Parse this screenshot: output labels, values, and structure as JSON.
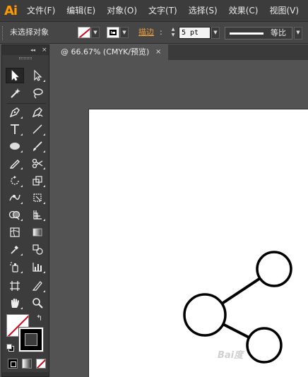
{
  "app": {
    "logo": "Ai"
  },
  "menu": [
    "文件(F)",
    "编辑(E)",
    "对象(O)",
    "文字(T)",
    "选择(S)",
    "效果(C)",
    "视图(V)"
  ],
  "control_bar": {
    "selection_status": "未选择对象",
    "stroke_label": "描边",
    "stroke_colon": ":",
    "stroke_weight": "5 pt",
    "profile_label": "等比"
  },
  "document_tab": {
    "title": "@ 66.67% (CMYK/预览)",
    "close_glyph": "×"
  },
  "tools_panel": {
    "collapse_glyph": "◂◂",
    "close_glyph": "×",
    "swap_glyph": "↰"
  },
  "colors": {
    "accent_logo": "#ff9a00",
    "stroke_label": "#f0a040",
    "none_slash": "#d0021b"
  },
  "watermark": "Bai度"
}
